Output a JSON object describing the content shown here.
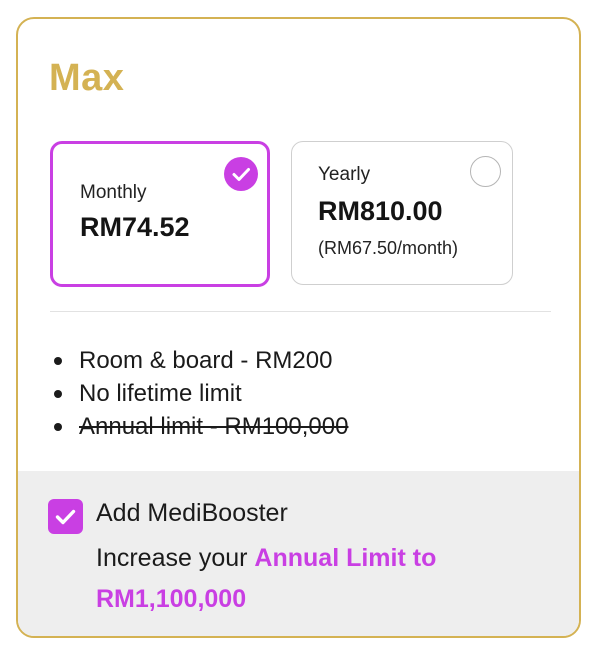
{
  "plan": {
    "name": "Max"
  },
  "billing_options": [
    {
      "label": "Monthly",
      "price": "RM74.52",
      "selected": true
    },
    {
      "label": "Yearly",
      "price": "RM810.00",
      "sub_price": "(RM67.50/month)",
      "selected": false
    }
  ],
  "benefits": [
    {
      "text": "Room & board - RM200",
      "struck": false
    },
    {
      "text": "No lifetime limit",
      "struck": false
    },
    {
      "text": "Annual limit - RM100,000",
      "struck": true
    }
  ],
  "addon": {
    "checked": true,
    "title": "Add MediBooster",
    "desc_prefix": "Increase your ",
    "desc_highlight": "Annual Limit to RM1,100,000"
  },
  "colors": {
    "plan_title": "#d4b253",
    "card_border": "#d4b253",
    "accent": "#c93fe3",
    "addon_background": "#eeeeee"
  },
  "icons": {
    "selected_indicator": "check-circle-icon",
    "unselected_indicator": "empty-radio-icon",
    "addon_checkbox": "checkbox-checked-icon"
  }
}
